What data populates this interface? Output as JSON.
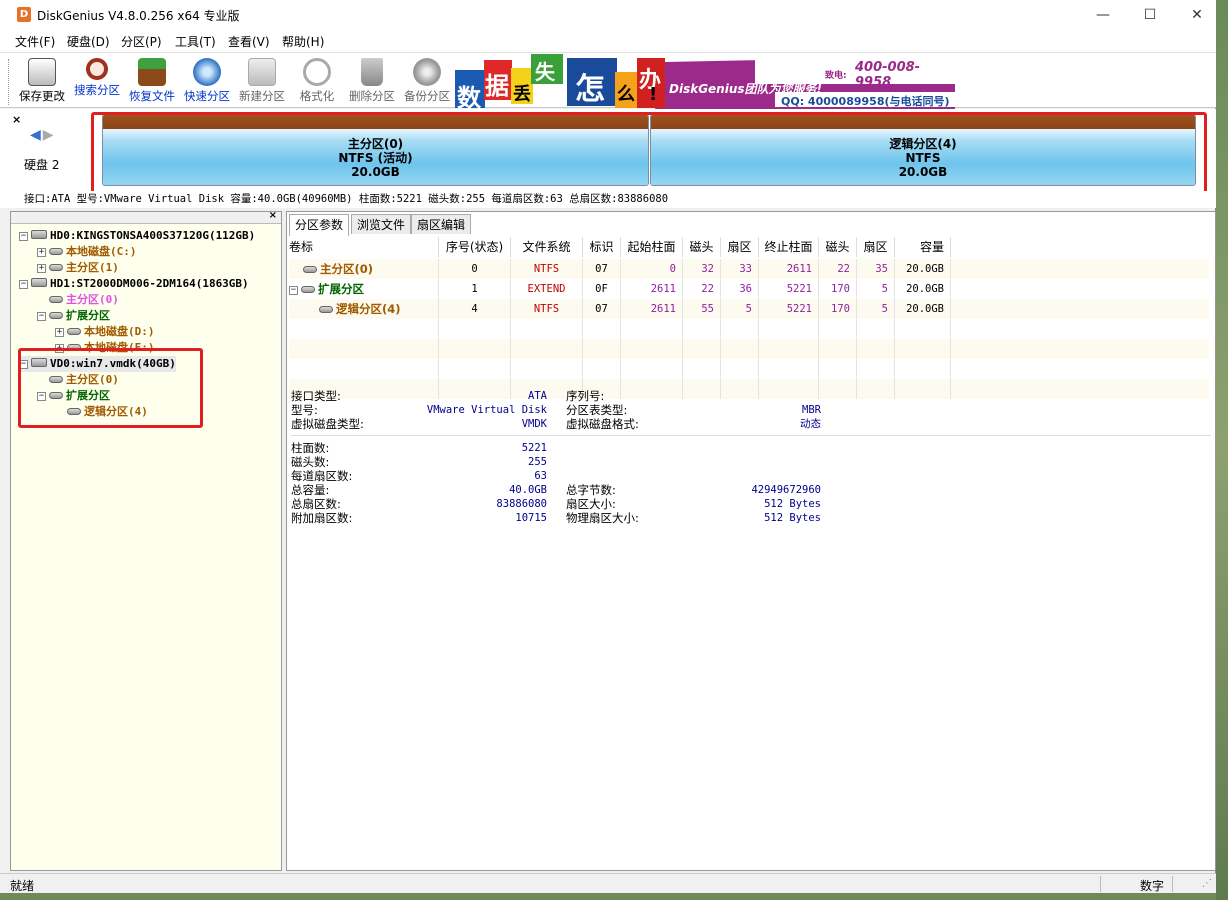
{
  "window": {
    "title": "DiskGenius V4.8.0.256 x64 专业版",
    "controls": [
      "—",
      "☐",
      "✕"
    ]
  },
  "menu": [
    "文件(F)",
    "硬盘(D)",
    "分区(P)",
    "工具(T)",
    "查看(V)",
    "帮助(H)"
  ],
  "toolbar": {
    "buttons": [
      {
        "label": "保存更改",
        "icon": "save-icon"
      },
      {
        "label": "搜索分区",
        "icon": "magnifier-icon"
      },
      {
        "label": "恢复文件",
        "icon": "recover-icon"
      },
      {
        "label": "快速分区",
        "icon": "quick-partition-icon"
      },
      {
        "label": "新建分区",
        "icon": "new-partition-icon"
      },
      {
        "label": "格式化",
        "icon": "format-icon"
      },
      {
        "label": "删除分区",
        "icon": "trash-icon"
      },
      {
        "label": "备份分区",
        "icon": "backup-icon"
      }
    ],
    "banner": {
      "chars": [
        "数",
        "据",
        "丢",
        "失",
        "怎",
        "么",
        "办",
        "!"
      ],
      "slogan": "DiskGenius团队为您服务!",
      "phone_label": "致电:",
      "phone": "400-008-9958",
      "qq": "QQ: 4000089958(与电话同号)"
    }
  },
  "diskmap": {
    "close": "×",
    "disk_label": "硬盘 2",
    "partitions": [
      {
        "name": "主分区(0)",
        "fs": "NTFS (活动)",
        "size": "20.0GB"
      },
      {
        "name": "逻辑分区(4)",
        "fs": "NTFS",
        "size": "20.0GB"
      }
    ],
    "info": "接口:ATA  型号:VMware Virtual Disk  容量:40.0GB(40960MB)  柱面数:5221  磁头数:255  每道扇区数:63  总扇区数:83886080"
  },
  "tree": [
    {
      "label": "HD0:KINGSTONSA400S37120G(112GB)",
      "level": 0,
      "expander": "⊟",
      "color": "hd"
    },
    {
      "label": "本地磁盘(C:)",
      "level": 1,
      "expander": "⊞",
      "color": "brown"
    },
    {
      "label": "主分区(1)",
      "level": 1,
      "expander": "⊞",
      "color": "brown"
    },
    {
      "label": "HD1:ST2000DM006-2DM164(1863GB)",
      "level": 0,
      "expander": "⊟",
      "color": "hd"
    },
    {
      "label": "主分区(0)",
      "level": 1,
      "expander": "",
      "color": "pink"
    },
    {
      "label": "扩展分区",
      "level": 1,
      "expander": "⊟",
      "color": "green"
    },
    {
      "label": "本地磁盘(D:)",
      "level": 2,
      "expander": "⊞",
      "color": "brown"
    },
    {
      "label": "本地磁盘(E:)",
      "level": 2,
      "expander": "⊞",
      "color": "brown"
    },
    {
      "label": "VD0:win7.vmdk(40GB)",
      "level": 0,
      "expander": "⊟",
      "color": "hd"
    },
    {
      "label": "主分区(0)",
      "level": 1,
      "expander": "",
      "color": "brown"
    },
    {
      "label": "扩展分区",
      "level": 1,
      "expander": "⊟",
      "color": "green"
    },
    {
      "label": "逻辑分区(4)",
      "level": 2,
      "expander": "",
      "color": "brown"
    }
  ],
  "tabs": [
    "分区参数",
    "浏览文件",
    "扇区编辑"
  ],
  "table": {
    "headers": [
      "卷标",
      "序号(状态)",
      "文件系统",
      "标识",
      "起始柱面",
      "磁头",
      "扇区",
      "终止柱面",
      "磁头",
      "扇区",
      "容量"
    ],
    "rows": [
      [
        "主分区(0)",
        "0",
        "NTFS",
        "07",
        "0",
        "32",
        "33",
        "2611",
        "22",
        "35",
        "20.0GB"
      ],
      [
        "扩展分区",
        "1",
        "EXTEND",
        "0F",
        "2611",
        "22",
        "36",
        "5221",
        "170",
        "5",
        "20.0GB"
      ],
      [
        "逻辑分区(4)",
        "4",
        "NTFS",
        "07",
        "2611",
        "55",
        "5",
        "5221",
        "170",
        "5",
        "20.0GB"
      ]
    ]
  },
  "details": {
    "left1": [
      {
        "k": "接口类型:",
        "v": "ATA"
      },
      {
        "k": "型号:",
        "v": "VMware Virtual Disk"
      },
      {
        "k": "虚拟磁盘类型:",
        "v": "VMDK"
      }
    ],
    "right1": [
      {
        "k": "序列号:",
        "v": ""
      },
      {
        "k": "分区表类型:",
        "v": "MBR"
      },
      {
        "k": "虚拟磁盘格式:",
        "v": "动态"
      }
    ],
    "left2": [
      {
        "k": "柱面数:",
        "v": "5221"
      },
      {
        "k": "磁头数:",
        "v": "255"
      },
      {
        "k": "每道扇区数:",
        "v": "63"
      },
      {
        "k": "总容量:",
        "v": "40.0GB"
      },
      {
        "k": "总扇区数:",
        "v": "83886080"
      },
      {
        "k": "附加扇区数:",
        "v": "10715"
      }
    ],
    "right2": [
      {
        "k": "总字节数:",
        "v": "42949672960"
      },
      {
        "k": "扇区大小:",
        "v": "512 Bytes"
      },
      {
        "k": "物理扇区大小:",
        "v": "512 Bytes"
      }
    ]
  },
  "status": {
    "left": "就绪",
    "right": "数字"
  },
  "colors": {
    "highlight_frame": "#e02020",
    "partition_top": "#8c4416",
    "partition_body": "#6ec4ec"
  }
}
